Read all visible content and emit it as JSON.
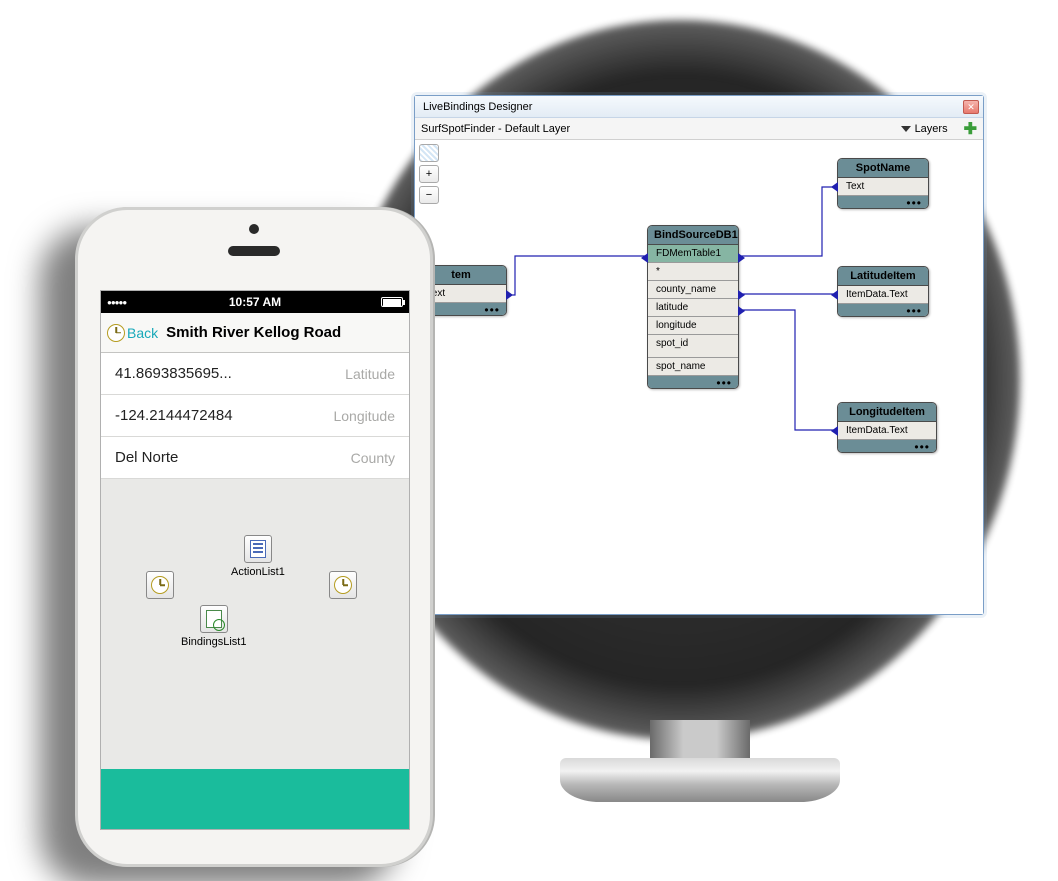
{
  "designer": {
    "title": "LiveBindings Designer",
    "layer_label": "SurfSpotFinder  - Default Layer",
    "layers_button": "Layers",
    "close_glyph": "✕",
    "nodes": {
      "bind_source": {
        "title": "BindSourceDB1",
        "rows": [
          "FDMemTable1",
          "*",
          "county_name",
          "latitude",
          "longitude",
          "spot_id",
          "spot_name"
        ]
      },
      "partial_item": {
        "title_suffix": "tem",
        "row": ".Text"
      },
      "spot_name": {
        "title": "SpotName",
        "row": "Text"
      },
      "latitude_item": {
        "title": "LatitudeItem",
        "row": "ItemData.Text"
      },
      "longitude_item": {
        "title": "LongitudeItem",
        "row": "ItemData.Text"
      }
    }
  },
  "phone": {
    "status_time": "10:57 AM",
    "back_label": "Back",
    "page_title": "Smith River Kellog Road",
    "rows": [
      {
        "value": "41.8693835695...",
        "label": "Latitude"
      },
      {
        "value": "-124.2144472484",
        "label": "Longitude"
      },
      {
        "value": "Del Norte",
        "label": "County"
      }
    ],
    "components": {
      "actionlist": "ActionList1",
      "bindingslist": "BindingsList1"
    }
  }
}
